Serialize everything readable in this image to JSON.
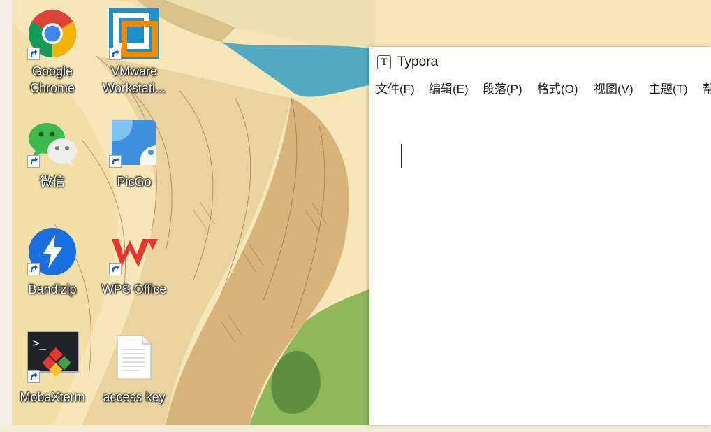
{
  "desktop": {
    "icons": [
      {
        "label": "Google\nChrome",
        "icon": "chrome-icon"
      },
      {
        "label": "VMware\nWorkstati...",
        "icon": "vmware-icon"
      },
      {
        "label": "微信",
        "icon": "wechat-icon"
      },
      {
        "label": "PicGo",
        "icon": "picgo-icon"
      },
      {
        "label": "Bandizip",
        "icon": "bandizip-icon"
      },
      {
        "label": "WPS Office",
        "icon": "wps-office-icon"
      },
      {
        "label": "MobaXterm",
        "icon": "mobaxterm-icon"
      },
      {
        "label": "access key",
        "icon": "text-file-icon"
      }
    ]
  },
  "typora": {
    "title": "Typora",
    "app_icon_letter": "T",
    "menu": [
      "文件(F)",
      "编辑(E)",
      "段落(P)",
      "格式(O)",
      "视图(V)",
      "主题(T)",
      "帮"
    ]
  },
  "colors": {
    "chrome_red": "#db4437",
    "chrome_yellow": "#f4b400",
    "chrome_green": "#0f9d58",
    "chrome_blue": "#4285f4",
    "vmware_blue": "#1d91d0",
    "vmware_orange": "#f38b00",
    "wechat_green": "#3eb94e",
    "picgo_blue": "#3d8fe0",
    "bandizip_blue": "#1a6fe0",
    "wps_red": "#e8352d",
    "water": "#3fa3c2",
    "grass": "#8fb85a"
  }
}
